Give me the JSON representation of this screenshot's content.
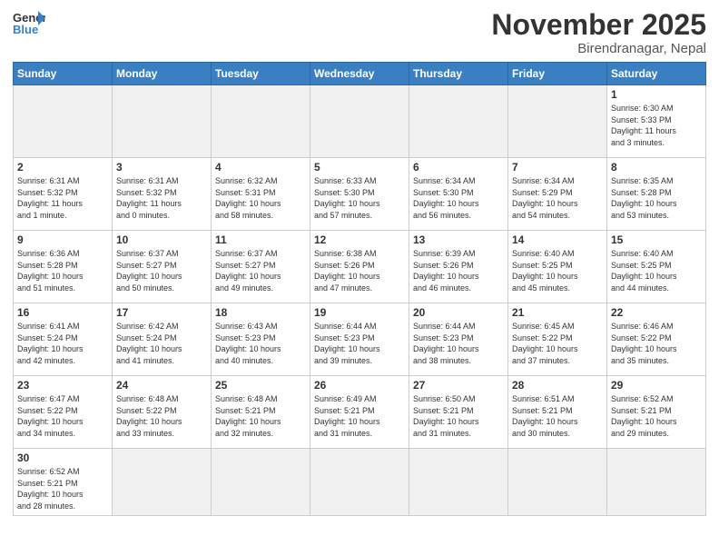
{
  "header": {
    "logo_general": "General",
    "logo_blue": "Blue",
    "month_title": "November 2025",
    "subtitle": "Birendranagar, Nepal"
  },
  "weekdays": [
    "Sunday",
    "Monday",
    "Tuesday",
    "Wednesday",
    "Thursday",
    "Friday",
    "Saturday"
  ],
  "weeks": [
    [
      {
        "day": "",
        "info": "",
        "empty": true
      },
      {
        "day": "",
        "info": "",
        "empty": true
      },
      {
        "day": "",
        "info": "",
        "empty": true
      },
      {
        "day": "",
        "info": "",
        "empty": true
      },
      {
        "day": "",
        "info": "",
        "empty": true
      },
      {
        "day": "",
        "info": "",
        "empty": true
      },
      {
        "day": "1",
        "info": "Sunrise: 6:30 AM\nSunset: 5:33 PM\nDaylight: 11 hours\nand 3 minutes.",
        "empty": false
      }
    ],
    [
      {
        "day": "2",
        "info": "Sunrise: 6:31 AM\nSunset: 5:32 PM\nDaylight: 11 hours\nand 1 minute.",
        "empty": false
      },
      {
        "day": "3",
        "info": "Sunrise: 6:31 AM\nSunset: 5:32 PM\nDaylight: 11 hours\nand 0 minutes.",
        "empty": false
      },
      {
        "day": "4",
        "info": "Sunrise: 6:32 AM\nSunset: 5:31 PM\nDaylight: 10 hours\nand 58 minutes.",
        "empty": false
      },
      {
        "day": "5",
        "info": "Sunrise: 6:33 AM\nSunset: 5:30 PM\nDaylight: 10 hours\nand 57 minutes.",
        "empty": false
      },
      {
        "day": "6",
        "info": "Sunrise: 6:34 AM\nSunset: 5:30 PM\nDaylight: 10 hours\nand 56 minutes.",
        "empty": false
      },
      {
        "day": "7",
        "info": "Sunrise: 6:34 AM\nSunset: 5:29 PM\nDaylight: 10 hours\nand 54 minutes.",
        "empty": false
      },
      {
        "day": "8",
        "info": "Sunrise: 6:35 AM\nSunset: 5:28 PM\nDaylight: 10 hours\nand 53 minutes.",
        "empty": false
      }
    ],
    [
      {
        "day": "9",
        "info": "Sunrise: 6:36 AM\nSunset: 5:28 PM\nDaylight: 10 hours\nand 51 minutes.",
        "empty": false
      },
      {
        "day": "10",
        "info": "Sunrise: 6:37 AM\nSunset: 5:27 PM\nDaylight: 10 hours\nand 50 minutes.",
        "empty": false
      },
      {
        "day": "11",
        "info": "Sunrise: 6:37 AM\nSunset: 5:27 PM\nDaylight: 10 hours\nand 49 minutes.",
        "empty": false
      },
      {
        "day": "12",
        "info": "Sunrise: 6:38 AM\nSunset: 5:26 PM\nDaylight: 10 hours\nand 47 minutes.",
        "empty": false
      },
      {
        "day": "13",
        "info": "Sunrise: 6:39 AM\nSunset: 5:26 PM\nDaylight: 10 hours\nand 46 minutes.",
        "empty": false
      },
      {
        "day": "14",
        "info": "Sunrise: 6:40 AM\nSunset: 5:25 PM\nDaylight: 10 hours\nand 45 minutes.",
        "empty": false
      },
      {
        "day": "15",
        "info": "Sunrise: 6:40 AM\nSunset: 5:25 PM\nDaylight: 10 hours\nand 44 minutes.",
        "empty": false
      }
    ],
    [
      {
        "day": "16",
        "info": "Sunrise: 6:41 AM\nSunset: 5:24 PM\nDaylight: 10 hours\nand 42 minutes.",
        "empty": false
      },
      {
        "day": "17",
        "info": "Sunrise: 6:42 AM\nSunset: 5:24 PM\nDaylight: 10 hours\nand 41 minutes.",
        "empty": false
      },
      {
        "day": "18",
        "info": "Sunrise: 6:43 AM\nSunset: 5:23 PM\nDaylight: 10 hours\nand 40 minutes.",
        "empty": false
      },
      {
        "day": "19",
        "info": "Sunrise: 6:44 AM\nSunset: 5:23 PM\nDaylight: 10 hours\nand 39 minutes.",
        "empty": false
      },
      {
        "day": "20",
        "info": "Sunrise: 6:44 AM\nSunset: 5:23 PM\nDaylight: 10 hours\nand 38 minutes.",
        "empty": false
      },
      {
        "day": "21",
        "info": "Sunrise: 6:45 AM\nSunset: 5:22 PM\nDaylight: 10 hours\nand 37 minutes.",
        "empty": false
      },
      {
        "day": "22",
        "info": "Sunrise: 6:46 AM\nSunset: 5:22 PM\nDaylight: 10 hours\nand 35 minutes.",
        "empty": false
      }
    ],
    [
      {
        "day": "23",
        "info": "Sunrise: 6:47 AM\nSunset: 5:22 PM\nDaylight: 10 hours\nand 34 minutes.",
        "empty": false
      },
      {
        "day": "24",
        "info": "Sunrise: 6:48 AM\nSunset: 5:22 PM\nDaylight: 10 hours\nand 33 minutes.",
        "empty": false
      },
      {
        "day": "25",
        "info": "Sunrise: 6:48 AM\nSunset: 5:21 PM\nDaylight: 10 hours\nand 32 minutes.",
        "empty": false
      },
      {
        "day": "26",
        "info": "Sunrise: 6:49 AM\nSunset: 5:21 PM\nDaylight: 10 hours\nand 31 minutes.",
        "empty": false
      },
      {
        "day": "27",
        "info": "Sunrise: 6:50 AM\nSunset: 5:21 PM\nDaylight: 10 hours\nand 31 minutes.",
        "empty": false
      },
      {
        "day": "28",
        "info": "Sunrise: 6:51 AM\nSunset: 5:21 PM\nDaylight: 10 hours\nand 30 minutes.",
        "empty": false
      },
      {
        "day": "29",
        "info": "Sunrise: 6:52 AM\nSunset: 5:21 PM\nDaylight: 10 hours\nand 29 minutes.",
        "empty": false
      }
    ],
    [
      {
        "day": "30",
        "info": "Sunrise: 6:52 AM\nSunset: 5:21 PM\nDaylight: 10 hours\nand 28 minutes.",
        "empty": false
      },
      {
        "day": "",
        "info": "",
        "empty": true
      },
      {
        "day": "",
        "info": "",
        "empty": true
      },
      {
        "day": "",
        "info": "",
        "empty": true
      },
      {
        "day": "",
        "info": "",
        "empty": true
      },
      {
        "day": "",
        "info": "",
        "empty": true
      },
      {
        "day": "",
        "info": "",
        "empty": true
      }
    ]
  ]
}
